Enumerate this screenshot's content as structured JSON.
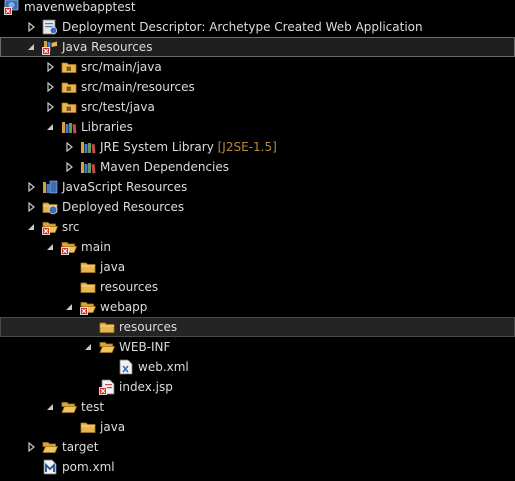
{
  "tree": {
    "project": {
      "label": "mavenwebapptest",
      "icon": "web-project-icon"
    },
    "deployment_descriptor": {
      "label": "Deployment Descriptor: Archetype Created Web Application",
      "icon": "deployment-descriptor-icon"
    },
    "java_resources": {
      "label": "Java Resources",
      "icon": "java-resources-icon"
    },
    "src_main_java": {
      "label": "src/main/java",
      "icon": "package-folder-icon"
    },
    "src_main_resources": {
      "label": "src/main/resources",
      "icon": "package-folder-icon"
    },
    "src_test_java": {
      "label": "src/test/java",
      "icon": "package-folder-icon"
    },
    "libraries": {
      "label": "Libraries",
      "icon": "libraries-icon"
    },
    "jre_system_library": {
      "label": "JRE System Library",
      "decoration": "[J2SE-1.5]",
      "icon": "library-icon"
    },
    "maven_dependencies": {
      "label": "Maven Dependencies",
      "icon": "library-icon"
    },
    "javascript_resources": {
      "label": "JavaScript Resources",
      "icon": "javascript-resources-icon"
    },
    "deployed_resources": {
      "label": "Deployed Resources",
      "icon": "deployed-resources-icon"
    },
    "src": {
      "label": "src",
      "icon": "folder-error-icon"
    },
    "main": {
      "label": "main",
      "icon": "folder-error-icon"
    },
    "main_java": {
      "label": "java",
      "icon": "folder-icon"
    },
    "main_resources": {
      "label": "resources",
      "icon": "folder-icon"
    },
    "webapp": {
      "label": "webapp",
      "icon": "folder-error-icon"
    },
    "webapp_resources": {
      "label": "resources",
      "icon": "folder-icon"
    },
    "web_inf": {
      "label": "WEB-INF",
      "icon": "folder-icon"
    },
    "web_xml": {
      "label": "web.xml",
      "icon": "xml-file-icon"
    },
    "index_jsp": {
      "label": "index.jsp",
      "icon": "jsp-file-error-icon"
    },
    "test": {
      "label": "test",
      "icon": "folder-icon"
    },
    "test_java": {
      "label": "java",
      "icon": "folder-icon"
    },
    "target": {
      "label": "target",
      "icon": "folder-icon"
    },
    "pom_xml": {
      "label": "pom.xml",
      "icon": "maven-pom-icon"
    }
  },
  "colors": {
    "background": "#000000",
    "text": "#dcdcdc",
    "decoration": "#b5893d",
    "folder": "#e8b64c",
    "error": "#d42a2a"
  }
}
